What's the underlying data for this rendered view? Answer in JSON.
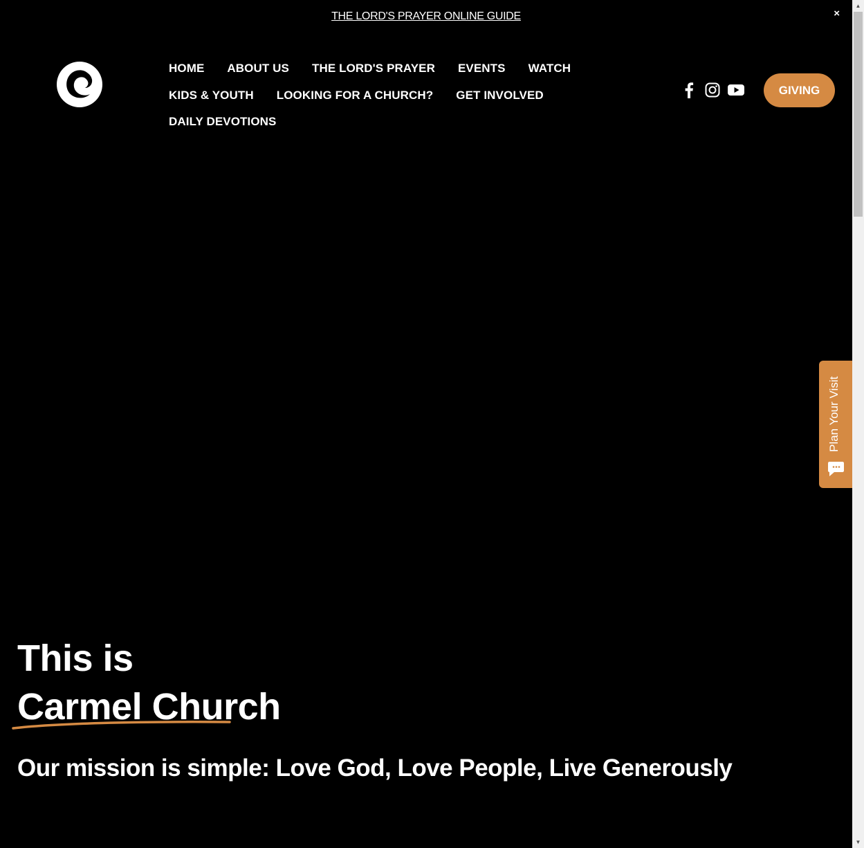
{
  "announcement": {
    "link_text": "THE LORD'S PRAYER ONLINE GUIDE",
    "close_glyph": "×"
  },
  "logo": {
    "icon": "carmel-c-logo-icon"
  },
  "nav": {
    "row1": [
      "HOME",
      "ABOUT US",
      "THE LORD'S PRAYER",
      "EVENTS",
      "WATCH"
    ],
    "row2": [
      "KIDS & YOUTH",
      "LOOKING FOR A CHURCH?",
      "GET INVOLVED"
    ],
    "row3": [
      "DAILY DEVOTIONS"
    ]
  },
  "social": {
    "icons": [
      "facebook-icon",
      "instagram-icon",
      "youtube-icon"
    ]
  },
  "giving_button": {
    "label": "GIVING"
  },
  "hero": {
    "line1": "This is",
    "line2": "Carmel Church",
    "mission": "Our mission is simple: Love God, Love People, Live Generously"
  },
  "plan_tab": {
    "label": "Plan Your Visit",
    "icon": "chat-bubble-icon"
  },
  "colors": {
    "background": "#000000",
    "accent": "#d58a43",
    "text": "#ffffff"
  }
}
